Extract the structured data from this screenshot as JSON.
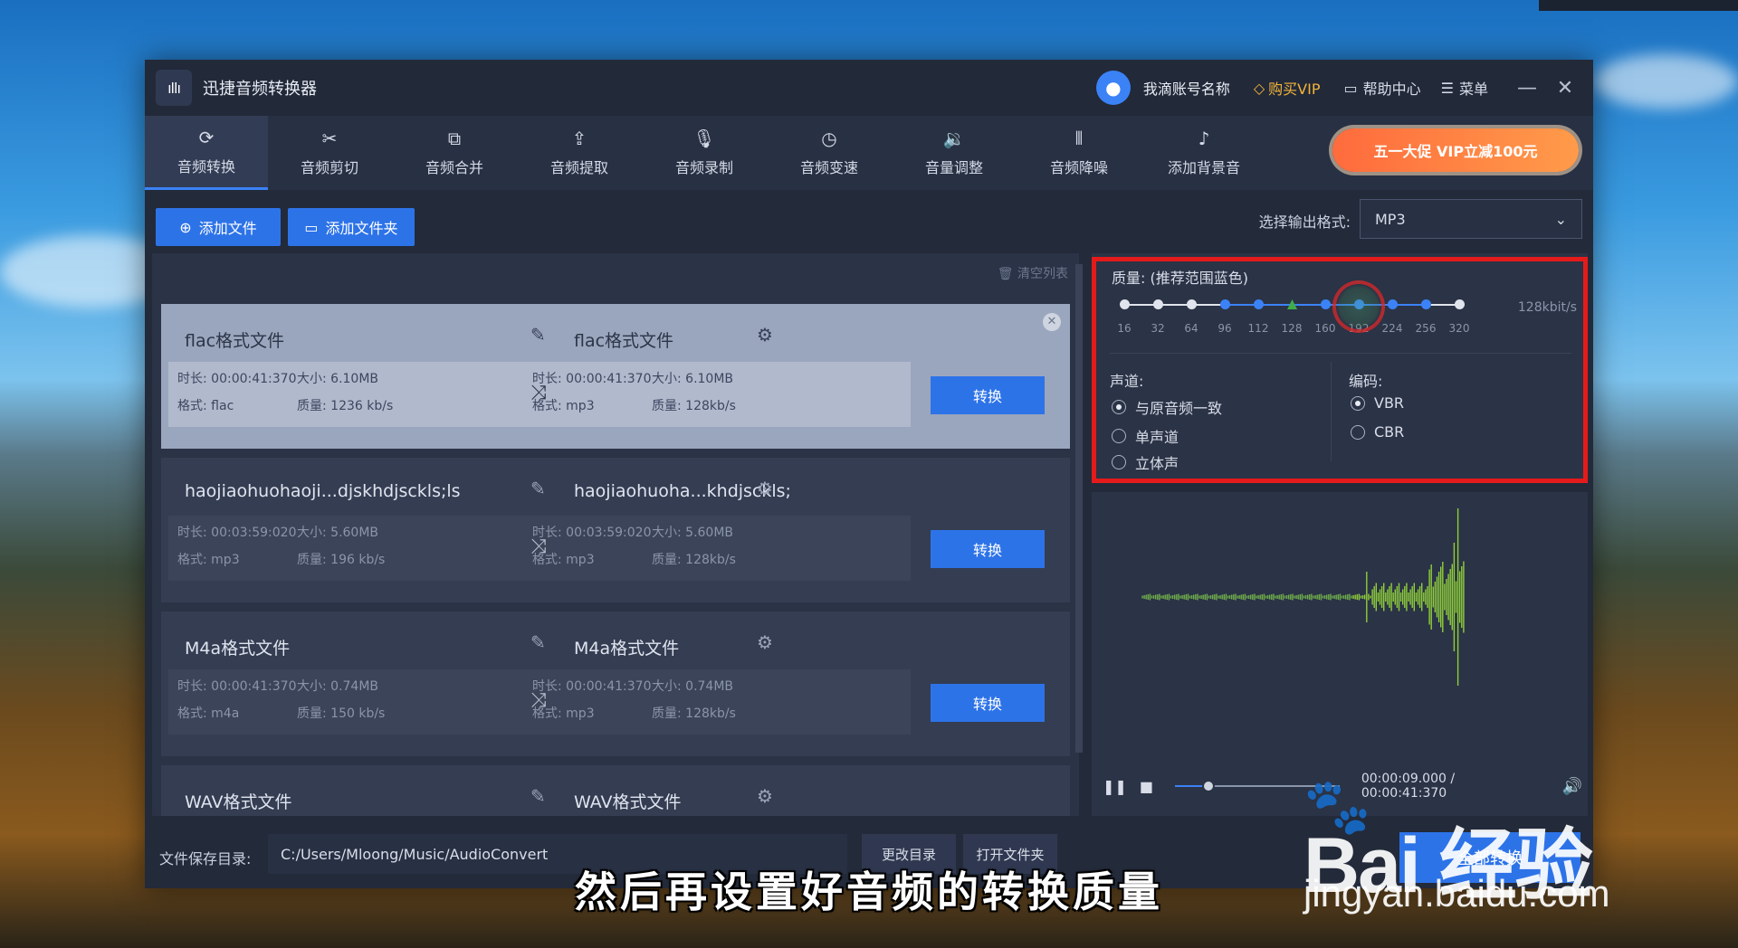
{
  "app": {
    "title": "迅捷音频转换器",
    "logo_icon": "waveform-logo"
  },
  "titlebar": {
    "account": "我滴账号名称",
    "vip": "购买VIP",
    "help": "帮助中心",
    "menu": "菜单",
    "minimize": "—",
    "close": "✕"
  },
  "tools": [
    {
      "label": "音频转换",
      "icon": "refresh-icon",
      "glyph": "⟳"
    },
    {
      "label": "音频剪切",
      "icon": "scissors-icon",
      "glyph": "✂"
    },
    {
      "label": "音频合并",
      "icon": "merge-icon",
      "glyph": "⧉"
    },
    {
      "label": "音频提取",
      "icon": "upload-icon",
      "glyph": "⇪"
    },
    {
      "label": "音频录制",
      "icon": "microphone-icon",
      "glyph": "🎙"
    },
    {
      "label": "音频变速",
      "icon": "speed-icon",
      "glyph": "◷"
    },
    {
      "label": "音量调整",
      "icon": "volume-icon",
      "glyph": "🔉"
    },
    {
      "label": "音频降噪",
      "icon": "equalizer-icon",
      "glyph": "⫴"
    },
    {
      "label": "添加背景音",
      "icon": "music-note-icon",
      "glyph": "♪"
    }
  ],
  "promo": "五一大促 VIP立减100元",
  "actions": {
    "add_file": "添加文件",
    "add_folder": "添加文件夹",
    "format_label": "选择输出格式:",
    "format_value": "MP3"
  },
  "list": {
    "clear": "清空列表",
    "files": [
      {
        "src_name": "flac格式文件",
        "dst_name": "flac格式文件",
        "src_duration": "时长: 00:00:41:370",
        "src_size": "大小: 6.10MB",
        "src_format": "格式: flac",
        "src_quality": "质量: 1236 kb/s",
        "dst_duration": "时长: 00:00:41:370",
        "dst_size": "大小: 6.10MB",
        "dst_format": "格式: mp3",
        "dst_quality": "质量: 128kb/s",
        "convert": "转换"
      },
      {
        "src_name": "haojiaohuohaoji...djskhdjsckls;ls",
        "dst_name": "haojiaohuoha...khdjsckls;",
        "src_duration": "时长: 00:03:59:020",
        "src_size": "大小: 5.60MB",
        "src_format": "格式: mp3",
        "src_quality": "质量: 196 kb/s",
        "dst_duration": "时长: 00:03:59:020",
        "dst_size": "大小: 5.60MB",
        "dst_format": "格式: mp3",
        "dst_quality": "质量: 128kb/s",
        "convert": "转换"
      },
      {
        "src_name": "M4a格式文件",
        "dst_name": "M4a格式文件",
        "src_duration": "时长: 00:00:41:370",
        "src_size": "大小: 0.74MB",
        "src_format": "格式: m4a",
        "src_quality": "质量: 150 kb/s",
        "dst_duration": "时长: 00:00:41:370",
        "dst_size": "大小: 0.74MB",
        "dst_format": "格式: mp3",
        "dst_quality": "质量: 128kb/s",
        "convert": "转换"
      },
      {
        "src_name": "WAV格式文件",
        "dst_name": "WAV格式文件"
      }
    ]
  },
  "quality": {
    "title": "质量: (推荐范围蓝色)",
    "ticks": [
      "16",
      "32",
      "64",
      "96",
      "112",
      "128",
      "160",
      "192",
      "224",
      "256",
      "320"
    ],
    "value": "128kbit/s",
    "channel_label": "声道:",
    "channels": [
      "与原音频一致",
      "单声道",
      "立体声"
    ],
    "encoding_label": "编码:",
    "encodings": [
      "VBR",
      "CBR"
    ]
  },
  "player": {
    "time": "00:00:09.000 / 00:00:41:370",
    "progress": 0.2
  },
  "bottom": {
    "save_label": "文件保存目录:",
    "save_path": "C:/Users/Mloong/Music/AudioConvert",
    "change_dir": "更改目录",
    "open_folder": "打开文件夹",
    "convert_all": "全部转换"
  },
  "subtitle": "然后再设置好音频的转换质量",
  "watermark": {
    "brand": "Bai 经验",
    "url": "jingyan.baidu.com"
  },
  "colors": {
    "accent": "#2d73e8",
    "highlight_red": "#e51b1b",
    "vip_gold": "#f3b43a",
    "wave_green": "#7ec63c"
  }
}
